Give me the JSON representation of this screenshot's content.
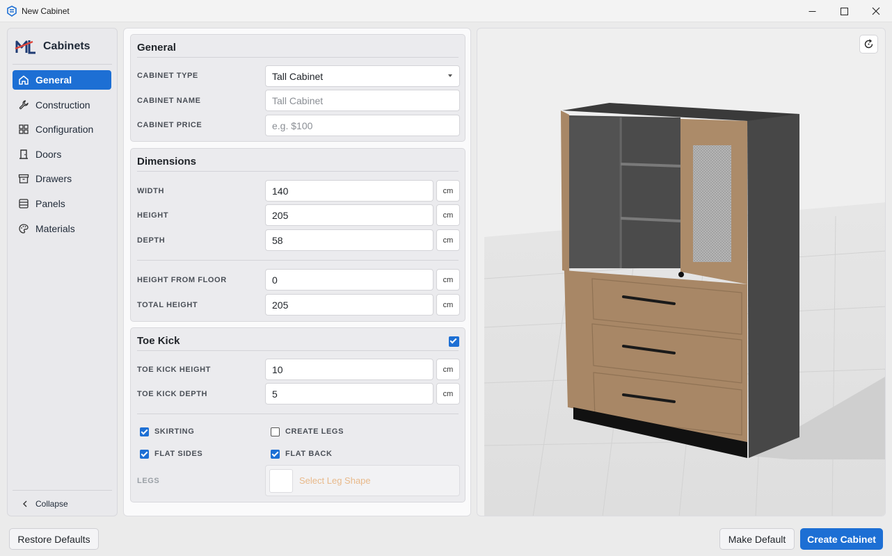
{
  "window": {
    "title": "New Cabinet"
  },
  "sidebar": {
    "brand": "Cabinets",
    "items": [
      {
        "label": "General",
        "icon": "home-icon",
        "active": true
      },
      {
        "label": "Construction",
        "icon": "wrench-icon",
        "active": false
      },
      {
        "label": "Configuration",
        "icon": "grid-icon",
        "active": false
      },
      {
        "label": "Doors",
        "icon": "door-icon",
        "active": false
      },
      {
        "label": "Drawers",
        "icon": "archive-icon",
        "active": false
      },
      {
        "label": "Panels",
        "icon": "panels-icon",
        "active": false
      },
      {
        "label": "Materials",
        "icon": "palette-icon",
        "active": false
      }
    ],
    "collapse_label": "Collapse"
  },
  "general": {
    "title": "General",
    "cabinet_type": {
      "label": "CABINET TYPE",
      "value": "Tall Cabinet"
    },
    "cabinet_name": {
      "label": "CABINET NAME",
      "placeholder": "Tall Cabinet"
    },
    "cabinet_price": {
      "label": "CABINET PRICE",
      "placeholder": "e.g. $100"
    }
  },
  "dimensions": {
    "title": "Dimensions",
    "width": {
      "label": "WIDTH",
      "value": "140",
      "unit": "cm"
    },
    "height": {
      "label": "HEIGHT",
      "value": "205",
      "unit": "cm"
    },
    "depth": {
      "label": "DEPTH",
      "value": "58",
      "unit": "cm"
    },
    "height_from_floor": {
      "label": "HEIGHT FROM FLOOR",
      "value": "0",
      "unit": "cm"
    },
    "total_height": {
      "label": "TOTAL HEIGHT",
      "value": "205",
      "unit": "cm"
    }
  },
  "toe_kick": {
    "title": "Toe Kick",
    "enabled": true,
    "height": {
      "label": "TOE KICK HEIGHT",
      "value": "10",
      "unit": "cm"
    },
    "depth": {
      "label": "TOE KICK DEPTH",
      "value": "5",
      "unit": "cm"
    },
    "skirting": {
      "label": "SKIRTING",
      "checked": true
    },
    "create_legs": {
      "label": "CREATE LEGS",
      "checked": false
    },
    "flat_sides": {
      "label": "FLAT SIDES",
      "checked": true
    },
    "flat_back": {
      "label": "FLAT BACK",
      "checked": true
    },
    "legs": {
      "label": "LEGS",
      "placeholder": "Select Leg Shape"
    }
  },
  "footer": {
    "restore_label": "Restore Defaults",
    "make_default_label": "Make Default",
    "create_label": "Create Cabinet"
  },
  "colors": {
    "accent": "#1d6fd4",
    "wood": "#a88766",
    "carcass": "#474747"
  }
}
